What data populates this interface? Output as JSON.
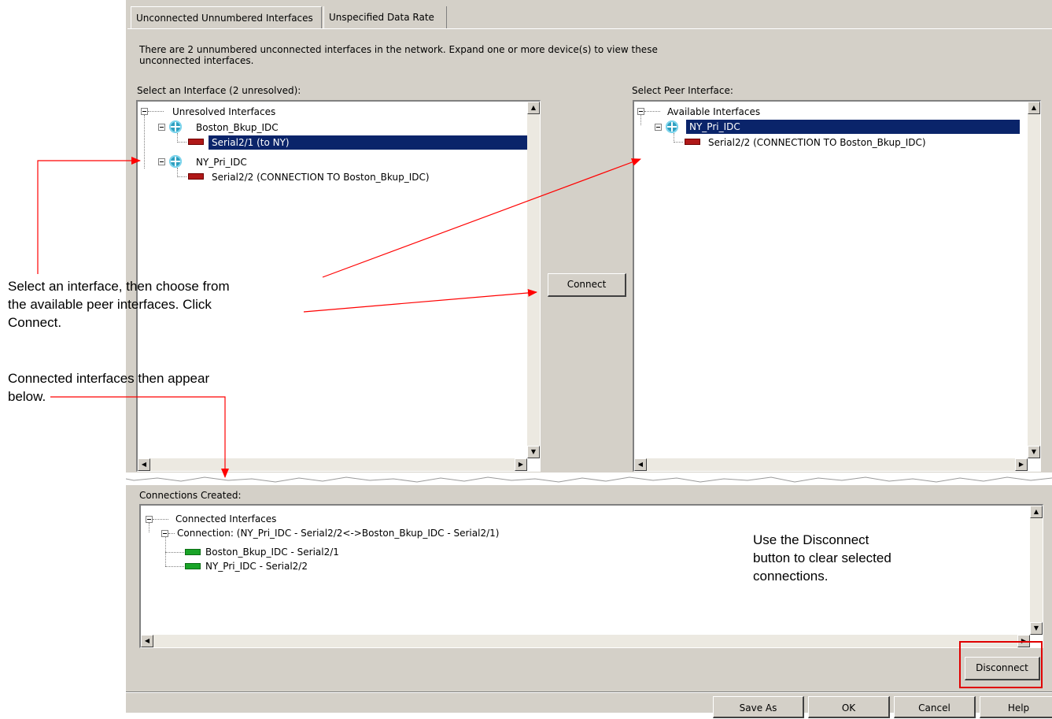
{
  "tabs": [
    "Unconnected Unnumbered Interfaces",
    "Unspecified Data Rate"
  ],
  "description": [
    "There are 2 unnumbered unconnected interfaces in the network. Expand one or more device(s) to view these",
    "unconnected interfaces."
  ],
  "left_panel": {
    "label": "Select an Interface (2 unresolved):",
    "root": "Unresolved Interfaces",
    "items": [
      {
        "device": "Boston_Bkup_IDC",
        "interface": "Serial2/1 (to NY)"
      },
      {
        "device": "NY_Pri_IDC",
        "interface": "Serial2/2 (CONNECTION TO Boston_Bkup_IDC)"
      }
    ]
  },
  "right_panel": {
    "label": "Select Peer Interface:",
    "root": "Available Interfaces",
    "device": "NY_Pri_IDC",
    "interface": "Serial2/2 (CONNECTION TO Boston_Bkup_IDC)"
  },
  "connect_label": "Connect",
  "connections": {
    "label": "Connections Created:",
    "root": "Connected Interfaces",
    "connection": "Connection: (NY_Pri_IDC - Serial2/2<->Boston_Bkup_IDC - Serial2/1)",
    "ends": [
      "Boston_Bkup_IDC - Serial2/1",
      "NY_Pri_IDC - Serial2/2"
    ]
  },
  "disconnect_label": "Disconnect",
  "footer": {
    "save_as": "Save As",
    "ok": "OK",
    "cancel": "Cancel",
    "help": "Help"
  },
  "annotations": {
    "select": [
      "Select an interface, then choose from",
      "the available peer interfaces. Click",
      "Connect."
    ],
    "connected": [
      "Connected interfaces then appear",
      "below."
    ],
    "disconnect": [
      "Use the Disconnect",
      "button to clear selected",
      "connections."
    ]
  },
  "colors": {
    "dialog": "#d4d0c8",
    "selection": "#0a246a",
    "arrow": "#ff0000",
    "router": "#2f9fbf",
    "interface_red": "#b01818",
    "interface_green": "#1aa428"
  },
  "icons": {
    "router": "router-icon",
    "interface_unresolved": "serial-interface-icon",
    "interface_connected": "connected-interface-icon"
  }
}
